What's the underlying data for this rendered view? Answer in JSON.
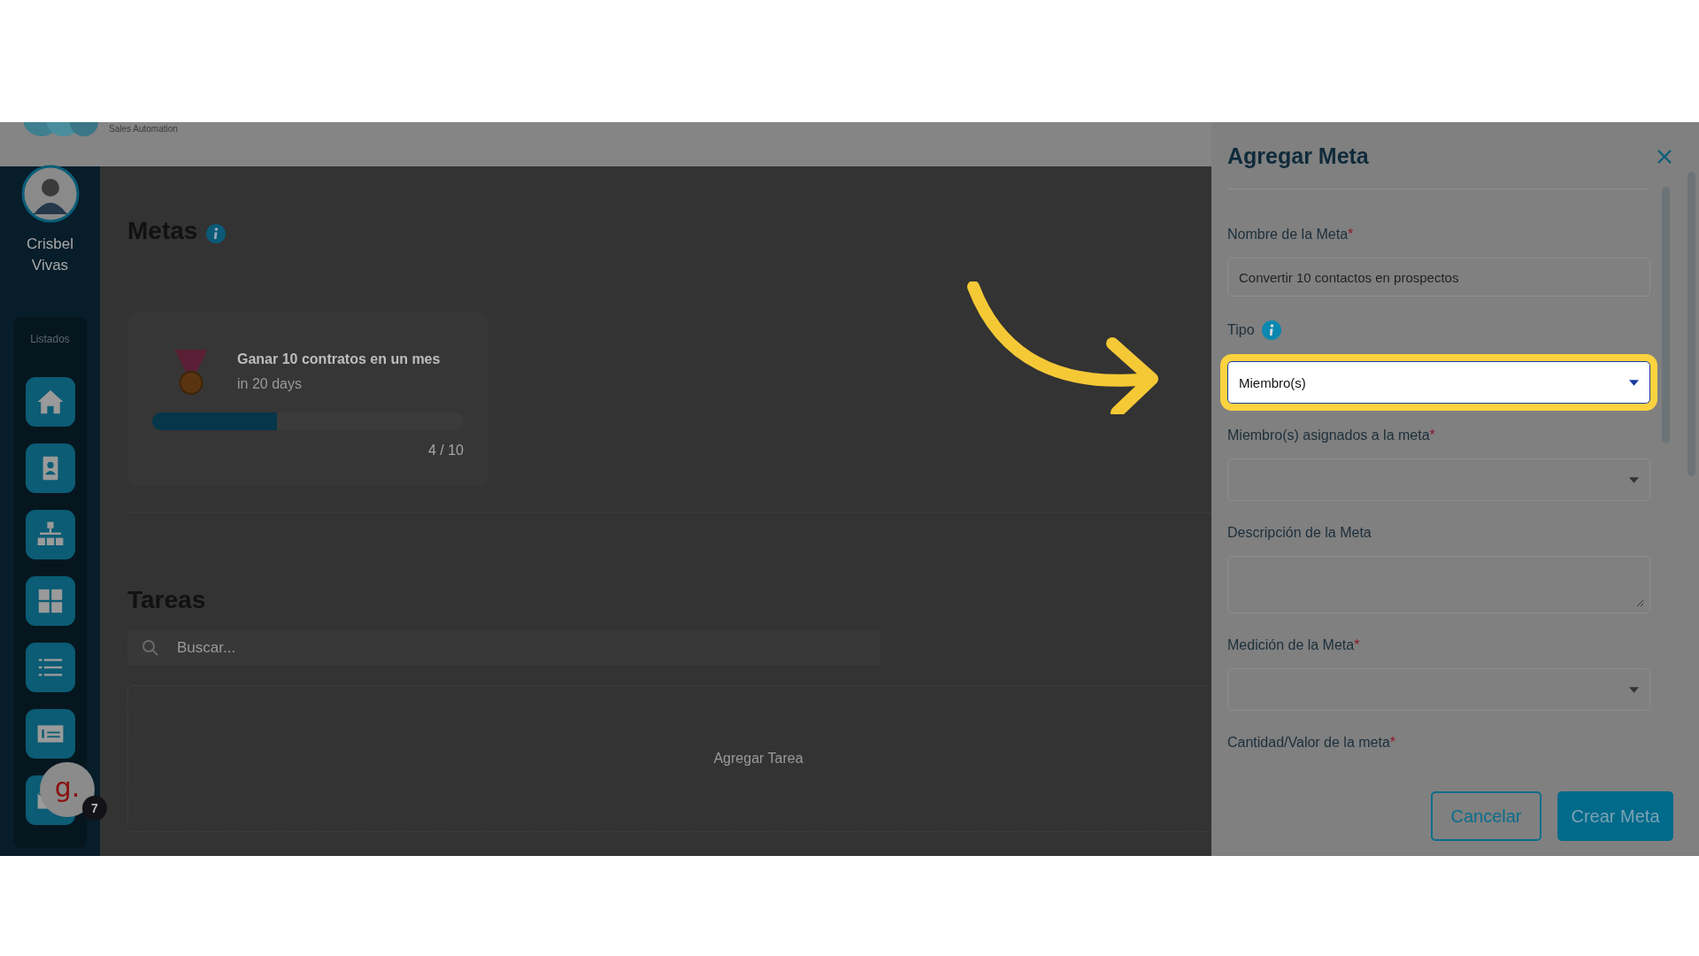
{
  "header": {
    "tagline": "Sales Automation"
  },
  "sidebar": {
    "user_name": "Crisbel Vivas",
    "section_label": "Listados",
    "nav_items": [
      {
        "kind": "home"
      },
      {
        "kind": "contact"
      },
      {
        "kind": "org"
      },
      {
        "kind": "grid"
      },
      {
        "kind": "list"
      },
      {
        "kind": "invoice"
      },
      {
        "kind": "mail"
      }
    ]
  },
  "chat_widget": {
    "letter": "g.",
    "badge": "7"
  },
  "goals": {
    "title": "Metas",
    "cards": [
      {
        "name": "Ganar 10 contratos en un mes",
        "due": "in 20 days",
        "level": 0.4,
        "progress": "4 / 10"
      }
    ]
  },
  "tasks": {
    "title": "Tareas",
    "search": {
      "placeholder": "Buscar..."
    },
    "empty_action": "Agregar Tarea"
  },
  "drawer": {
    "title": "Agregar Meta",
    "fields": [
      {
        "kind": "text",
        "label": "Nombre de la Meta",
        "required_mark": "*",
        "value": "Convertir 10 contactos en prospectos",
        "highlighted": false
      },
      {
        "kind": "select",
        "label": "Tipo",
        "info": true,
        "value": "Miembro(s)",
        "highlighted": true
      },
      {
        "kind": "select",
        "label": "Miembro(s) asignados a la meta",
        "required_mark": "*",
        "highlighted": false
      },
      {
        "kind": "textarea",
        "label": "Descripción de la Meta",
        "highlighted": false
      },
      {
        "kind": "select",
        "label": "Medición de la Meta",
        "required_mark": "*",
        "highlighted": false
      },
      {
        "kind": "label",
        "label": "Cantidad/Valor de la meta",
        "required_mark": "*"
      }
    ],
    "buttons": [
      {
        "kind": "secondary",
        "label": "Cancelar"
      },
      {
        "kind": "primary",
        "label": "Crear Meta"
      }
    ]
  }
}
